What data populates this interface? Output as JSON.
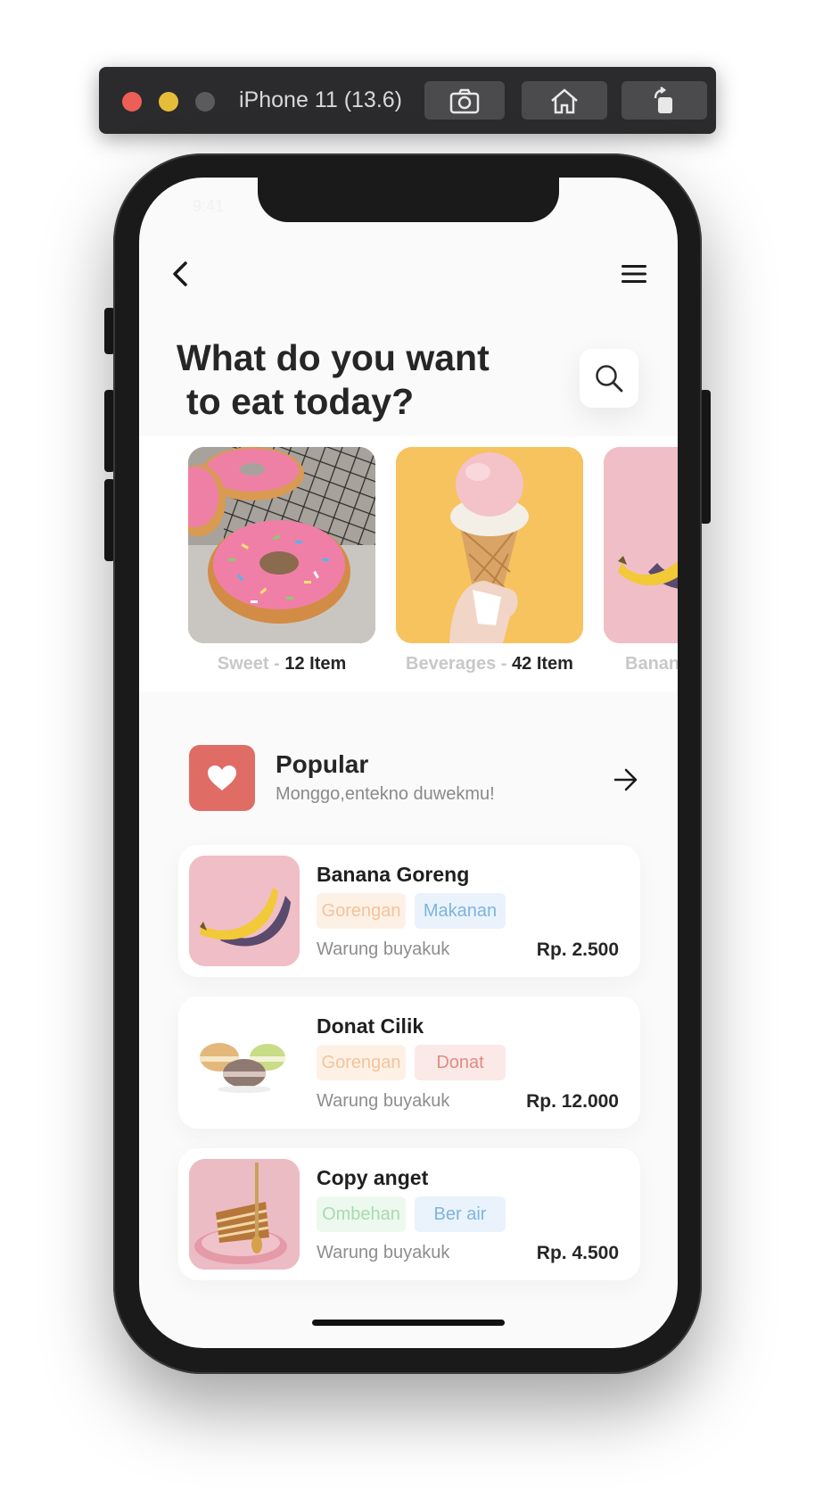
{
  "simulator": {
    "title": "iPhone 11 (13.6)",
    "screenshot_icon": "camera-icon",
    "home_icon": "home-icon",
    "rotate_icon": "rotate-icon"
  },
  "status_bar": {
    "time": "9:41"
  },
  "header": {
    "back_icon": "chevron-left-icon",
    "menu_icon": "hamburger-menu-icon"
  },
  "heading": {
    "line1": "What do you want",
    "line2": "to eat today?"
  },
  "search": {
    "icon": "search-icon"
  },
  "categories": [
    {
      "name": "Sweet",
      "separator": " - ",
      "count": "12 Item"
    },
    {
      "name": "Beverages",
      "separator": " - ",
      "count": "42 Item"
    },
    {
      "name": "Banan",
      "separator": "",
      "count": ""
    }
  ],
  "popular": {
    "title": "Popular",
    "subtitle": "Monggo,entekno duwekmu!",
    "icon": "heart-icon",
    "arrow_icon": "arrow-right-icon"
  },
  "foods": [
    {
      "name": "Banana Goreng",
      "tags": [
        "Gorengan",
        "Makanan"
      ],
      "shop": "Warung buyakuk",
      "price": "Rp. 2.500"
    },
    {
      "name": "Donat Cilik",
      "tags": [
        "Gorengan",
        "Donat"
      ],
      "shop": "Warung buyakuk",
      "price": "Rp. 12.000"
    },
    {
      "name": "Copy anget",
      "tags": [
        "Ombehan",
        "Ber air"
      ],
      "shop": "Warung buyakuk",
      "price": "Rp. 4.500"
    }
  ],
  "colors": {
    "accent_red": "#e06c66",
    "tag_orange_bg": "#fdf1e6",
    "tag_orange_text": "#f4c39b",
    "tag_blue_bg": "#eaf3fb",
    "tag_blue_text": "#7fb4dd",
    "tag_red_bg": "#fbe9e7",
    "tag_red_text": "#e28a82",
    "tag_green_bg": "#edf8ee",
    "tag_green_text": "#a6dcae"
  }
}
